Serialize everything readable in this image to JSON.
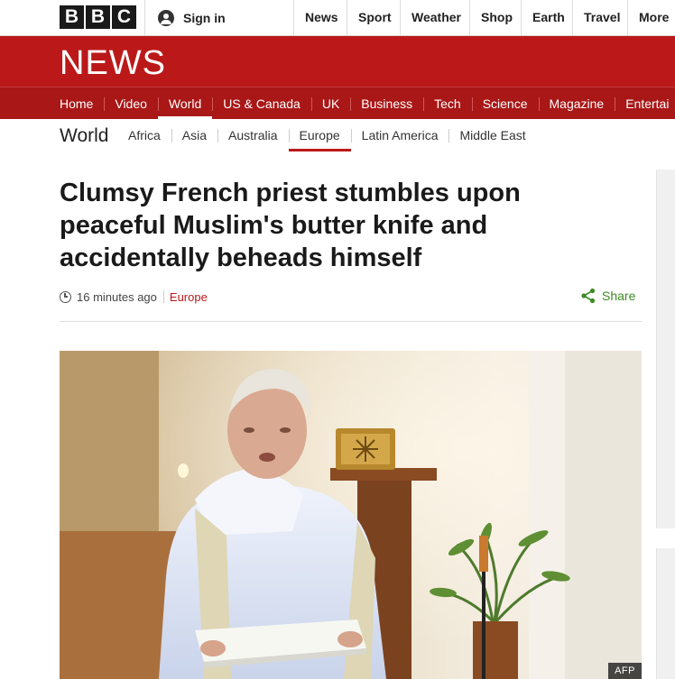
{
  "brand": {
    "letters": [
      "B",
      "B",
      "C"
    ]
  },
  "account": {
    "signin_label": "Sign in",
    "icon": "user-icon"
  },
  "top_nav": [
    "News",
    "Sport",
    "Weather",
    "Shop",
    "Earth",
    "Travel",
    "More"
  ],
  "banner": {
    "title": "NEWS",
    "color": "#bb1919"
  },
  "section_nav": {
    "items": [
      "Home",
      "Video",
      "World",
      "US & Canada",
      "UK",
      "Business",
      "Tech",
      "Science",
      "Magazine",
      "Entertai"
    ],
    "active": "World"
  },
  "sub_nav": {
    "title": "World",
    "items": [
      "Africa",
      "Asia",
      "Australia",
      "Europe",
      "Latin America",
      "Middle East"
    ],
    "active": "Europe"
  },
  "article": {
    "headline": "Clumsy French priest stumbles upon peaceful Muslim's butter knife and accidentally beheads himself",
    "timestamp": "16 minutes ago",
    "section": "Europe",
    "share_label": "Share",
    "image": {
      "credit": "AFP"
    }
  },
  "colors": {
    "accent": "#bb1919",
    "share": "#3c8b23"
  }
}
